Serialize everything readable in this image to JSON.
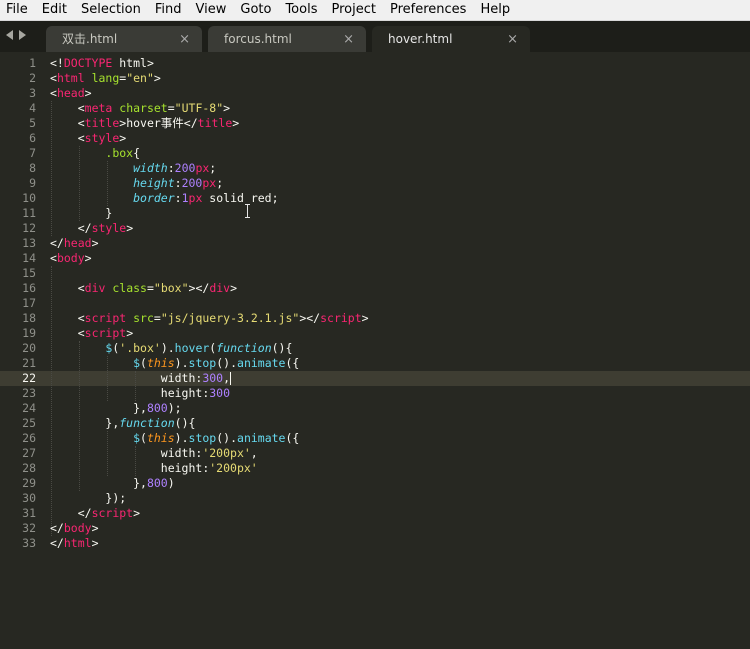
{
  "menu": [
    "File",
    "Edit",
    "Selection",
    "Find",
    "View",
    "Goto",
    "Tools",
    "Project",
    "Preferences",
    "Help"
  ],
  "tabs": [
    {
      "label": "双击.html",
      "close": "×"
    },
    {
      "label": "forcus.html",
      "close": "×"
    },
    {
      "label": "hover.html",
      "close": "×"
    }
  ],
  "line_numbers": [
    "1",
    "2",
    "3",
    "4",
    "5",
    "6",
    "7",
    "8",
    "9",
    "10",
    "11",
    "12",
    "13",
    "14",
    "15",
    "16",
    "17",
    "18",
    "19",
    "20",
    "21",
    "22",
    "23",
    "24",
    "25",
    "26",
    "27",
    "28",
    "29",
    "30",
    "31",
    "32",
    "33"
  ],
  "code": {
    "l1a": "<!",
    "l1b": "DOCTYPE",
    "l1c": " html>",
    "l2a": "<",
    "l2b": "html",
    "l2c": " lang",
    "l2d": "=",
    "l2e": "\"en\"",
    "l2f": ">",
    "l3a": "<",
    "l3b": "head",
    "l3c": ">",
    "l4a": "<",
    "l4b": "meta",
    "l4c": " charset",
    "l4d": "=",
    "l4e": "\"UTF-8\"",
    "l4f": ">",
    "l5a": "<",
    "l5b": "title",
    "l5c": ">hover事件</",
    "l5d": "title",
    "l5e": ">",
    "l6a": "<",
    "l6b": "style",
    "l6c": ">",
    "l7a": ".box",
    "l7b": "{",
    "l8a": "width",
    "l8b": ":",
    "l8c": "200",
    "l8d": "px",
    "l8e": ";",
    "l9a": "height",
    "l9b": ":",
    "l9c": "200",
    "l9d": "px",
    "l9e": ";",
    "l10a": "border",
    "l10b": ":",
    "l10c": "1",
    "l10d": "px",
    "l10e": " solid red",
    ";": ";",
    "l11": "}",
    "l12a": "</",
    "l12b": "style",
    "l12c": ">",
    "l13a": "</",
    "l13b": "head",
    "l13c": ">",
    "l14a": "<",
    "l14b": "body",
    "l14c": ">",
    "l16a": "<",
    "l16b": "div",
    "l16c": " class",
    "l16d": "=",
    "l16e": "\"box\"",
    "l16f": "></",
    "l16g": "div",
    "l16h": ">",
    "l18a": "<",
    "l18b": "script",
    "l18c": " src",
    "l18d": "=",
    "l18e": "\"js/jquery-3.2.1.js\"",
    "l18f": "></",
    "l18g": "script",
    "l18h": ">",
    "l19a": "<",
    "l19b": "script",
    "l19c": ">",
    "l20a": "$",
    "l20b": "(",
    "l20c": "'.box'",
    "l20d": ").",
    "l20e": "hover",
    "l20f": "(",
    "l20g": "function",
    "l20h": "(){",
    "l21a": "$",
    "l21b": "(",
    "l21c": "this",
    "l21d": ").",
    "l21e": "stop",
    "l21f": "().",
    "l21g": "animate",
    "l21h": "({",
    "l22a": "width:",
    "l22b": "300",
    ",": ",",
    "l23a": "height:",
    "l23b": "300",
    "l24a": "},",
    "l24b": "800",
    "l24c": ");",
    "l25a": "},",
    "l25b": "function",
    "l25c": "(){",
    "l26a": "$",
    "l26b": "(",
    "l26c": "this",
    "l26d": ").",
    "l26e": "stop",
    "l26f": "().",
    "l26g": "animate",
    "l26h": "({",
    "l27a": "width:",
    "l27b": "'200px'",
    "l27c": ",",
    "l28a": "height:",
    "l28b": "'200px'",
    "l29a": "},",
    "l29b": "800",
    "l29c": ")",
    "l30": "});",
    "l31a": "</",
    "l31b": "script",
    "l31c": ">",
    "l32a": "</",
    "l32b": "body",
    "l32c": ">",
    "l33a": "</",
    "l33b": "html",
    "l33c": ">"
  },
  "colors": {
    "background": "#272822",
    "tag": "#f92672",
    "attribute": "#a6e22e",
    "string": "#e6db74",
    "number": "#ae81ff",
    "keyword": "#66d9ef"
  }
}
